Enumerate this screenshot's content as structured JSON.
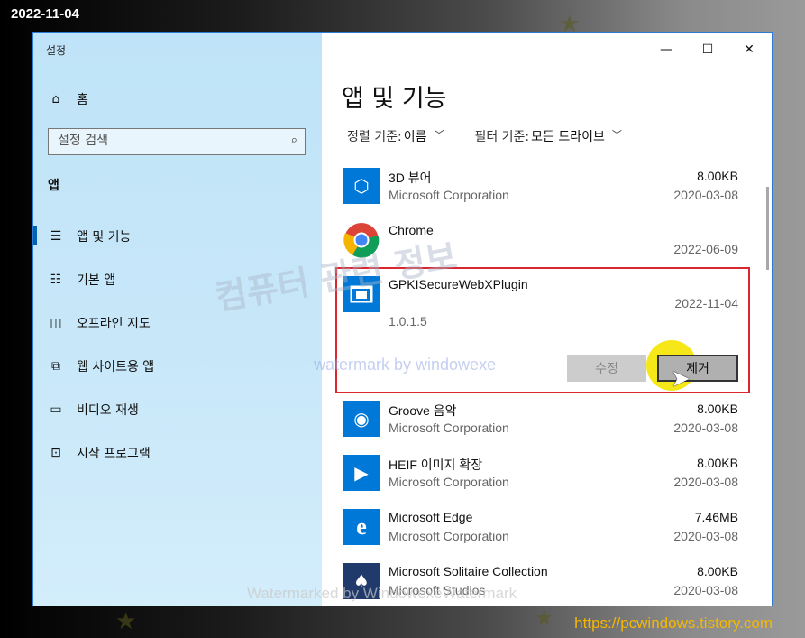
{
  "overlay": {
    "date_stamp": "2022-11-04",
    "site_url": "https://pcwindows.tistory.com",
    "watermark_korean": "컴퓨터 관련 정보",
    "watermark_text": "watermark by windowexe",
    "watermark_bottom": "Watermarked by WindowexeWatermark"
  },
  "window": {
    "title": "설정",
    "caption": {
      "minimize": "—",
      "maximize": "☐",
      "close": "✕"
    }
  },
  "sidebar": {
    "home": {
      "label": "홈",
      "icon": "home-icon"
    },
    "search": {
      "placeholder": "설정 검색",
      "icon": "search-icon"
    },
    "section": "앱",
    "items": [
      {
        "label": "앱 및 기능",
        "icon": "list-icon",
        "active": true
      },
      {
        "label": "기본 앱",
        "icon": "default-apps-icon"
      },
      {
        "label": "오프라인 지도",
        "icon": "map-icon"
      },
      {
        "label": "웹 사이트용 앱",
        "icon": "web-app-icon"
      },
      {
        "label": "비디오 재생",
        "icon": "video-icon"
      },
      {
        "label": "시작 프로그램",
        "icon": "startup-icon"
      }
    ]
  },
  "main": {
    "title": "앱 및 기능",
    "sort_label": "정렬 기준:",
    "sort_value": "이름",
    "filter_label": "필터 기준:",
    "filter_value": "모든 드라이브",
    "apps": [
      {
        "name": "3D 뷰어",
        "publisher": "Microsoft Corporation",
        "size": "8.00KB",
        "date": "2020-03-08",
        "icon": "cube-icon"
      },
      {
        "name": "Chrome",
        "publisher": "",
        "size": "",
        "date": "2022-06-09",
        "icon": "chrome-icon"
      },
      {
        "name": "GPKISecureWebXPlugin",
        "publisher": "",
        "size": "",
        "date": "2022-11-04",
        "version": "1.0.1.5",
        "icon": "plugin-window-icon",
        "selected": true
      },
      {
        "name": "Groove 음악",
        "publisher": "Microsoft Corporation",
        "size": "8.00KB",
        "date": "2020-03-08",
        "icon": "music-disc-icon"
      },
      {
        "name": "HEIF 이미지 확장",
        "publisher": "Microsoft Corporation",
        "size": "8.00KB",
        "date": "2020-03-08",
        "icon": "puzzle-play-icon"
      },
      {
        "name": "Microsoft Edge",
        "publisher": "Microsoft Corporation",
        "size": "7.46MB",
        "date": "2020-03-08",
        "icon": "edge-icon"
      },
      {
        "name": "Microsoft Solitaire Collection",
        "publisher": "Microsoft Studios",
        "size": "8.00KB",
        "date": "2020-03-08",
        "icon": "cards-icon"
      }
    ],
    "buttons": {
      "modify": "수정",
      "uninstall": "제거"
    }
  },
  "colors": {
    "accent": "#0078d7",
    "selection_border": "#d9262f",
    "sidebar_bg": "#c9e8f9",
    "highlight": "#f5e400"
  }
}
